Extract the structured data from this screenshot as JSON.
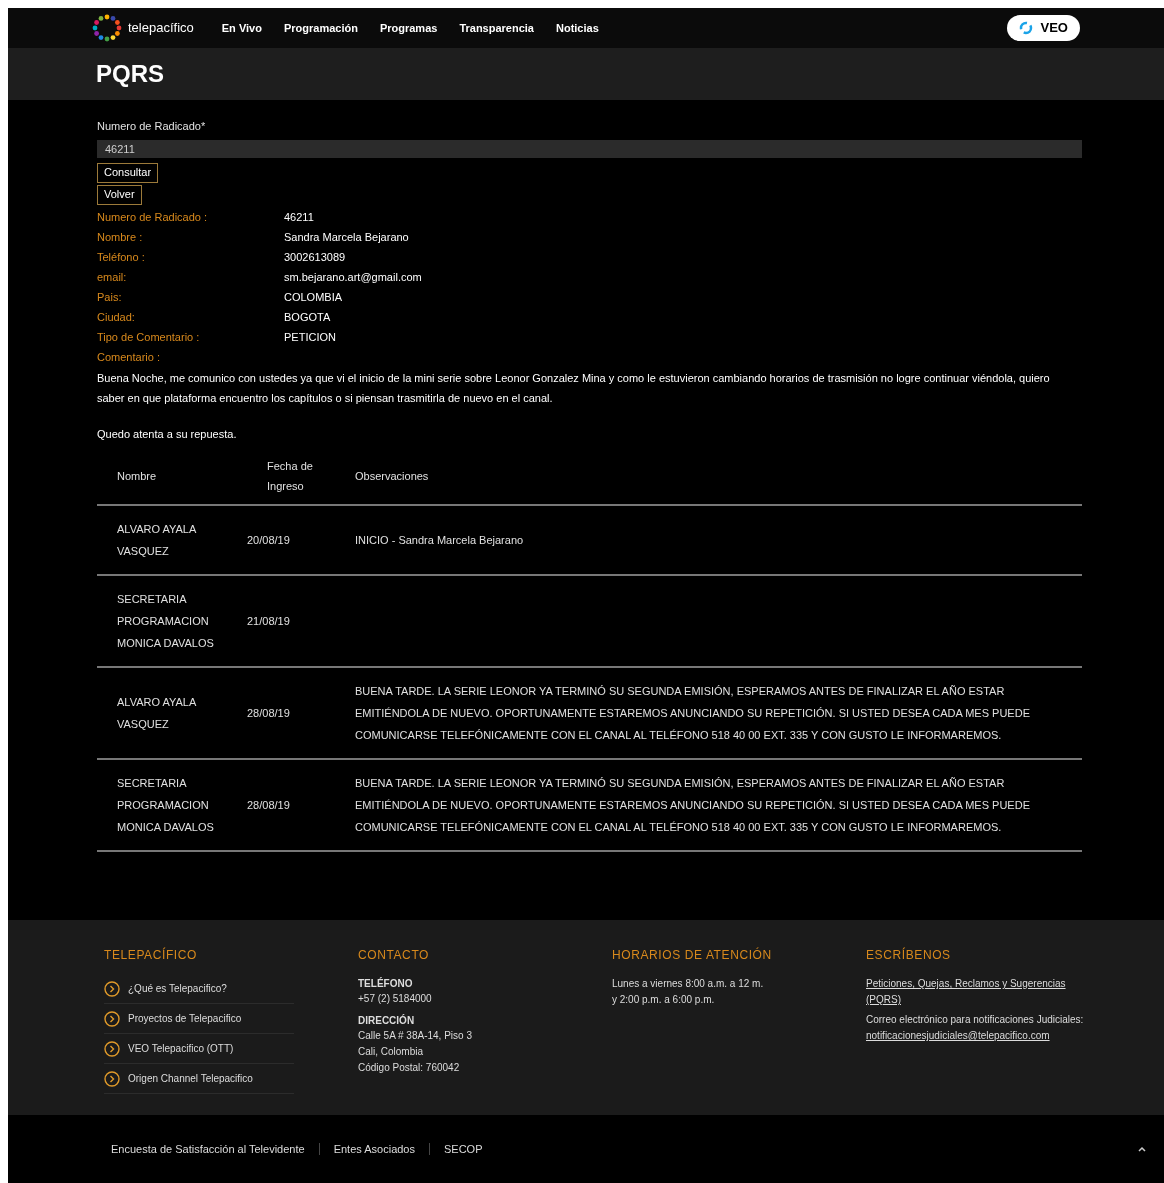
{
  "nav": {
    "brand": "telepacífico",
    "links": [
      "En Vivo",
      "Programación",
      "Programas",
      "Transparencia",
      "Noticias"
    ],
    "veo_button": "VEO"
  },
  "title": "PQRS",
  "form": {
    "label": "Numero de Radicado*",
    "value": "46211",
    "buttons": [
      "Consultar",
      "Volver"
    ]
  },
  "details": [
    {
      "label": "Numero de Radicado :",
      "value": "46211"
    },
    {
      "label": "Nombre :",
      "value": "Sandra Marcela Bejarano"
    },
    {
      "label": "Teléfono :",
      "value": "3002613089"
    },
    {
      "label": "email:",
      "value": "sm.bejarano.art@gmail.com"
    },
    {
      "label": "Pais:",
      "value": "COLOMBIA"
    },
    {
      "label": "Ciudad:",
      "value": "BOGOTA"
    },
    {
      "label": "Tipo de Comentario :",
      "value": "PETICION"
    }
  ],
  "comment_label": "Comentario :",
  "comment": [
    "Buena Noche, me comunico con ustedes ya que vi el inicio de la mini serie sobre Leonor Gonzalez Mina y como le estuvieron cambiando horarios de trasmisión no logre continuar viéndola, quiero saber en que plataforma encuentro los capítulos o si piensan trasmitirla de nuevo en el canal.",
    "Quedo atenta a su repuesta."
  ],
  "table": {
    "columns": [
      "Nombre",
      "Fecha de Ingreso",
      "Observaciones"
    ],
    "rows": [
      [
        "ALVARO AYALA VASQUEZ",
        "20/08/19",
        "INICIO - Sandra Marcela Bejarano"
      ],
      [
        "SECRETARIA PROGRAMACION MONICA DAVALOS",
        "21/08/19",
        ""
      ],
      [
        "ALVARO AYALA VASQUEZ",
        "28/08/19",
        "BUENA TARDE. LA SERIE LEONOR YA TERMINÓ SU SEGUNDA EMISIÓN, ESPERAMOS ANTES DE FINALIZAR EL AÑO ESTAR EMITIÉNDOLA DE NUEVO. OPORTUNAMENTE ESTAREMOS ANUNCIANDO SU REPETICIÓN. SI USTED DESEA CADA MES PUEDE COMUNICARSE TELEFÓNICAMENTE CON EL CANAL AL TELÉFONO 518 40 00 EXT. 335 Y CON GUSTO LE INFORMAREMOS."
      ],
      [
        "SECRETARIA PROGRAMACION MONICA DAVALOS",
        "28/08/19",
        "BUENA TARDE. LA SERIE LEONOR YA TERMINÓ SU SEGUNDA EMISIÓN, ESPERAMOS ANTES DE FINALIZAR EL AÑO ESTAR EMITIÉNDOLA DE NUEVO. OPORTUNAMENTE ESTAREMOS ANUNCIANDO SU REPETICIÓN. SI USTED DESEA CADA MES PUEDE COMUNICARSE TELEFÓNICAMENTE CON EL CANAL AL TELÉFONO 518 40 00 EXT. 335 Y CON GUSTO LE INFORMAREMOS."
      ]
    ]
  },
  "footer": {
    "telepacifico": {
      "heading": "TELEPACÍFICO",
      "links": [
        "¿Qué es Telepacifico?",
        "Proyectos de Telepacifico",
        "VEO Telepacifico (OTT)",
        "Origen Channel Telepacifico"
      ]
    },
    "contacto": {
      "heading": "CONTACTO",
      "phone_label": "TELÉFONO",
      "phone": "+57 (2) 5184000",
      "address_label": "DIRECCIÓN",
      "address": [
        "Calle 5A # 38A-14, Piso 3",
        "Cali, Colombia",
        "Código Postal: 760042"
      ]
    },
    "horarios": {
      "heading": "HORARIOS DE ATENCIÓN",
      "lines": [
        "Lunes a viernes 8:00 a.m. a 12 m.",
        "y 2:00 p.m. a 6:00 p.m."
      ]
    },
    "escribenos": {
      "heading": "ESCRÍBENOS",
      "pqrs_link": "Peticiones, Quejas, Reclamos y Sugerencias (PQRS)",
      "mail_text": "Correo electrónico para notificaciones Judiciales:",
      "mail_link": "notificacionesjudiciales@telepacifico.com"
    }
  },
  "bottom_links": [
    "Encuesta de Satisfacción al Televidente",
    "Entes Asociados",
    "SECOP"
  ]
}
